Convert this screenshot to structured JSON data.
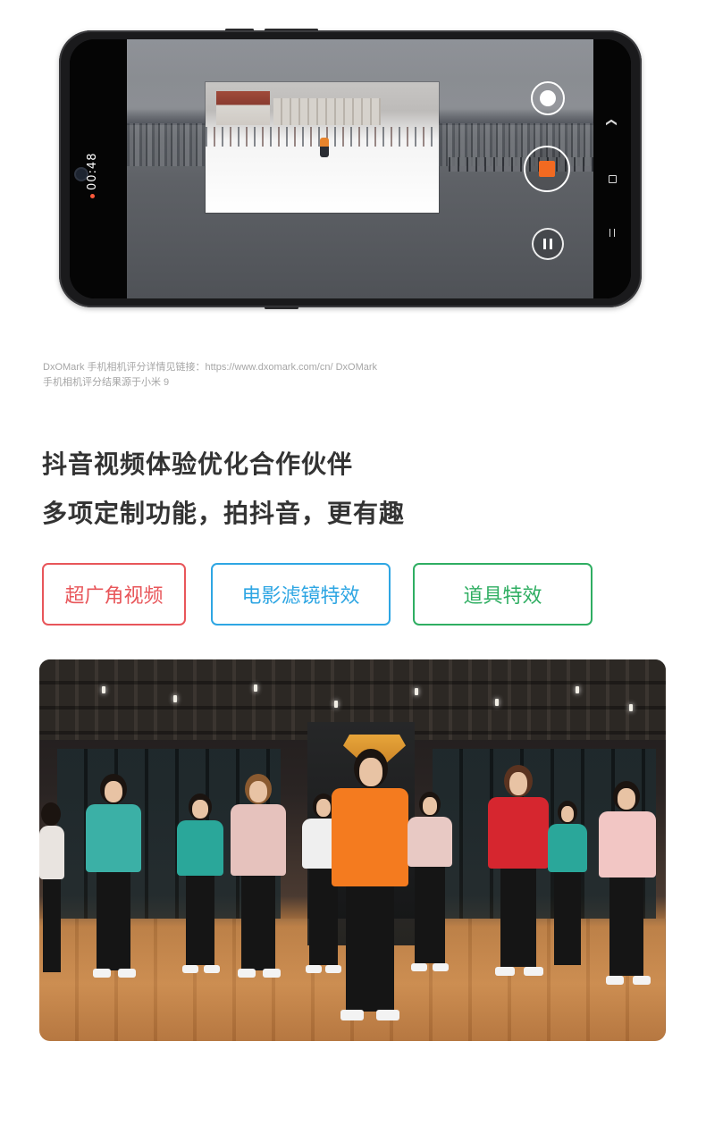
{
  "phone": {
    "recording_time": "00:48",
    "icons": {
      "snapshot": "shutter-icon",
      "stop": "stop-record-icon",
      "pause": "pause-icon",
      "nav_back": "chevron-down-icon",
      "nav_home": "square-home-icon",
      "nav_menu": "menu-bars-icon"
    },
    "colors": {
      "stop_accent": "#f26a21",
      "rec_dot": "#ff5a3c"
    }
  },
  "caption": {
    "line1": "DxOMark 手机相机评分详情见链接：https://www.dxomark.com/cn/ DxOMark",
    "line2": "手机相机评分结果源于小米 9"
  },
  "headline": {
    "line1": "抖音视频体验优化合作伙伴",
    "line2": "多项定制功能，拍抖音，更有趣"
  },
  "tags": [
    {
      "label": "超广角视频",
      "color": "#e8565a"
    },
    {
      "label": "电影滤镜特效",
      "color": "#2ea6e3"
    },
    {
      "label": "道具特效",
      "color": "#2fae62"
    }
  ]
}
